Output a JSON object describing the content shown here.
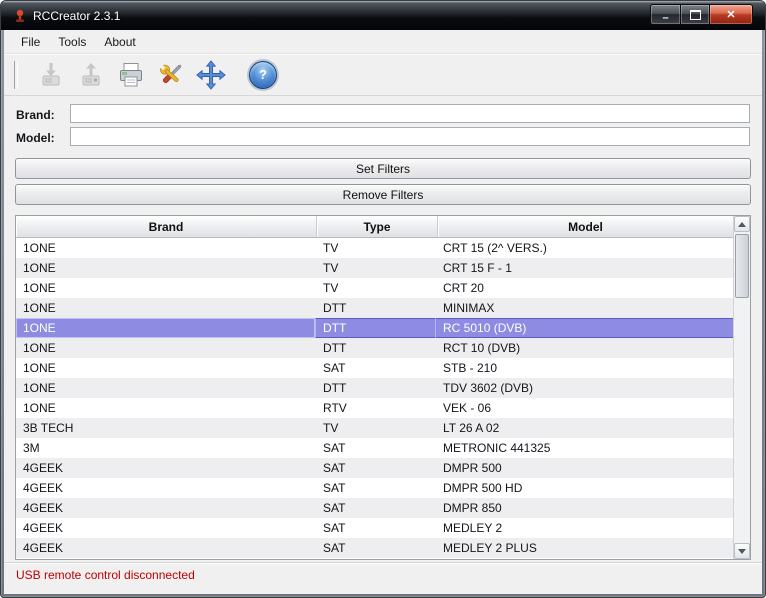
{
  "window": {
    "title": "RCCreator 2.3.1",
    "minimize_glyph": "–",
    "close_glyph": "✕"
  },
  "menu": {
    "items": [
      {
        "label": "File"
      },
      {
        "label": "Tools"
      },
      {
        "label": "About"
      }
    ]
  },
  "toolbar": {
    "help_glyph": "?",
    "icons": [
      "write-remote-icon",
      "read-remote-icon",
      "printer-icon",
      "tools-icon",
      "move-icon",
      "help-icon"
    ]
  },
  "filters": {
    "brand_label": "Brand:",
    "brand_value": "",
    "model_label": "Model:",
    "model_value": "",
    "set_filters_label": "Set Filters",
    "remove_filters_label": "Remove Filters"
  },
  "table": {
    "columns": [
      {
        "label": "Brand"
      },
      {
        "label": "Type"
      },
      {
        "label": "Model"
      }
    ],
    "selected_index": 4,
    "selection_color": "#8d8ce2",
    "rows": [
      {
        "brand": "1ONE",
        "type": "TV",
        "model": "CRT 15 (2^ VERS.)"
      },
      {
        "brand": "1ONE",
        "type": "TV",
        "model": "CRT 15 F - 1"
      },
      {
        "brand": "1ONE",
        "type": "TV",
        "model": "CRT 20"
      },
      {
        "brand": "1ONE",
        "type": "DTT",
        "model": "MINIMAX"
      },
      {
        "brand": "1ONE",
        "type": "DTT",
        "model": "RC 5010 (DVB)"
      },
      {
        "brand": "1ONE",
        "type": "DTT",
        "model": "RCT 10 (DVB)"
      },
      {
        "brand": "1ONE",
        "type": "SAT",
        "model": "STB - 210"
      },
      {
        "brand": "1ONE",
        "type": "DTT",
        "model": "TDV 3602 (DVB)"
      },
      {
        "brand": "1ONE",
        "type": "RTV",
        "model": "VEK - 06"
      },
      {
        "brand": "3B TECH",
        "type": "TV",
        "model": "LT 26 A 02"
      },
      {
        "brand": "3M",
        "type": "SAT",
        "model": "METRONIC 441325"
      },
      {
        "brand": "4GEEK",
        "type": "SAT",
        "model": "DMPR 500"
      },
      {
        "brand": "4GEEK",
        "type": "SAT",
        "model": "DMPR 500 HD"
      },
      {
        "brand": "4GEEK",
        "type": "SAT",
        "model": "DMPR 850"
      },
      {
        "brand": "4GEEK",
        "type": "SAT",
        "model": "MEDLEY 2"
      },
      {
        "brand": "4GEEK",
        "type": "SAT",
        "model": "MEDLEY 2 PLUS"
      }
    ]
  },
  "status": {
    "message": "USB remote control disconnected",
    "color": "#c00000"
  }
}
